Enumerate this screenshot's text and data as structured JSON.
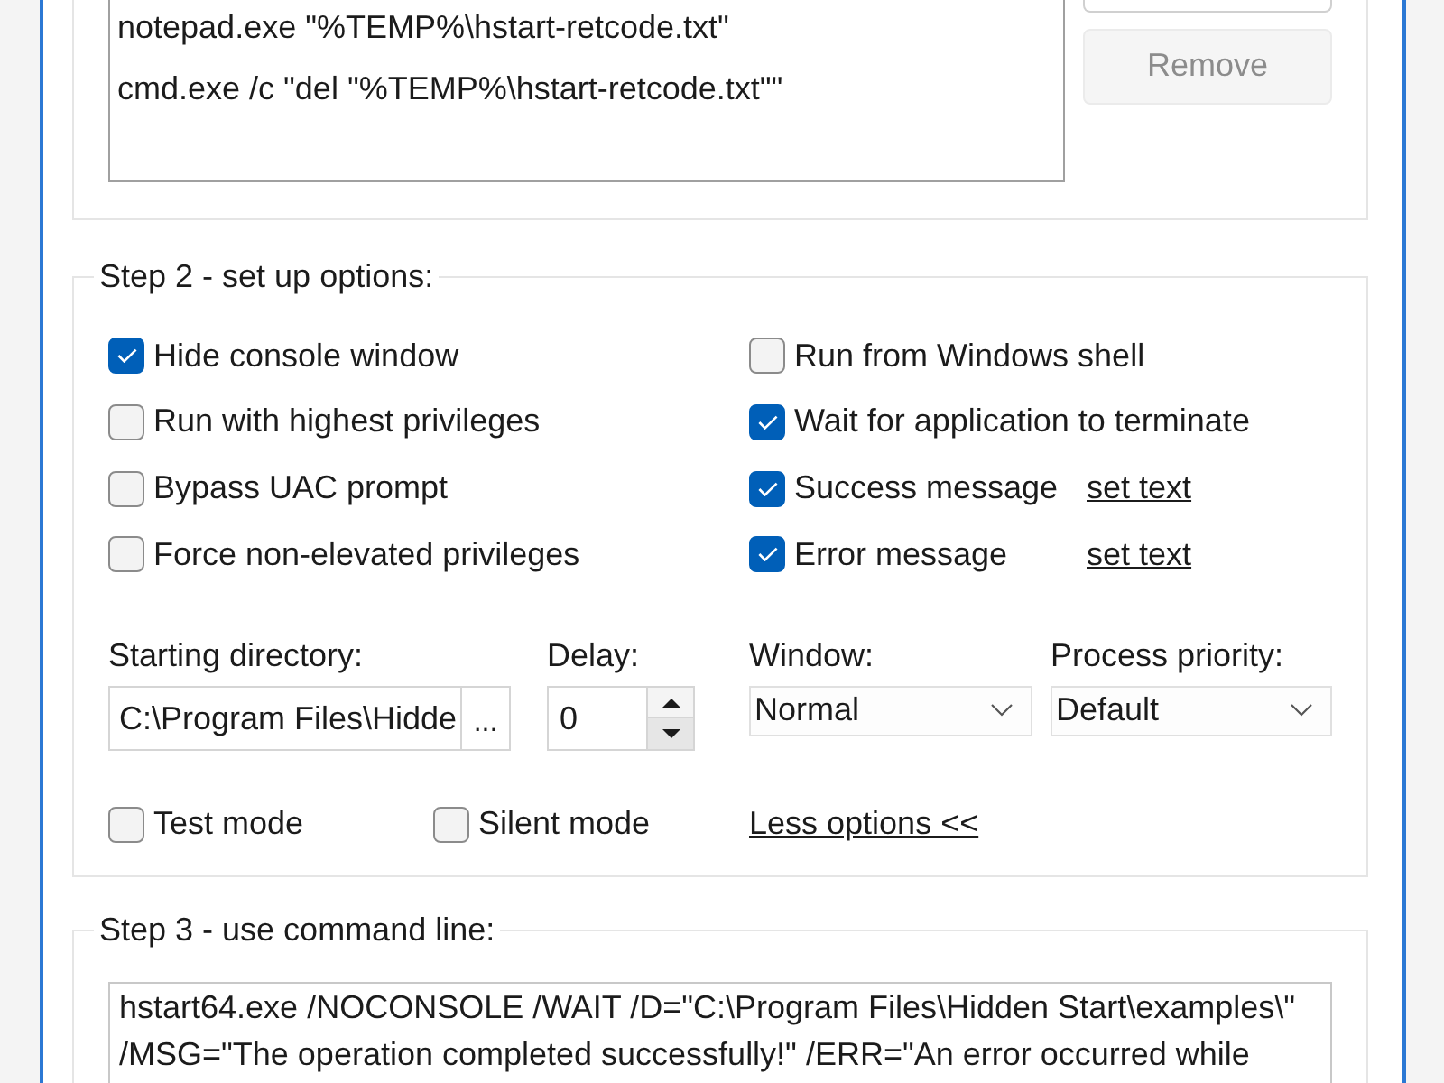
{
  "step1": {
    "commands": [
      "notepad.exe \"%TEMP%\\hstart-retcode.txt\"",
      "cmd.exe /c \"del \"%TEMP%\\hstart-retcode.txt\"\""
    ],
    "buttons": [
      {
        "disabled": false
      },
      {
        "label": "Remove",
        "disabled": true
      }
    ]
  },
  "step2": {
    "title": "Step 2 - set up options:",
    "options_left": [
      {
        "label": "Hide console window",
        "checked": true
      },
      {
        "label": "Run with highest privileges",
        "checked": false
      },
      {
        "label": "Bypass UAC prompt",
        "checked": false
      },
      {
        "label": "Force non-elevated privileges",
        "checked": false
      }
    ],
    "options_right": [
      {
        "label": "Run from Windows shell",
        "checked": false
      },
      {
        "label": "Wait for application to terminate",
        "checked": true
      },
      {
        "label": "Success message",
        "checked": true,
        "link": "set text"
      },
      {
        "label": "Error message",
        "checked": true,
        "link": "set text"
      }
    ],
    "starting_directory": {
      "label": "Starting directory:",
      "value": "C:\\Program Files\\Hidde",
      "browse_button": "..."
    },
    "delay": {
      "label": "Delay:",
      "value": "0"
    },
    "window": {
      "label": "Window:",
      "value": "Normal"
    },
    "process_priority": {
      "label": "Process priority:",
      "value": "Default"
    },
    "modes": [
      {
        "label": "Test mode",
        "checked": false
      },
      {
        "label": "Silent mode",
        "checked": false
      }
    ],
    "toggle_link": "Less options <<"
  },
  "step3": {
    "title": "Step 3 - use command line:",
    "command_line": "hstart64.exe /NOCONSOLE /WAIT /D=\"C:\\Program Files\\Hidden Start\\examples\\\" /MSG=\"The operation completed successfully!\" /ERR=\"An error occurred while"
  }
}
